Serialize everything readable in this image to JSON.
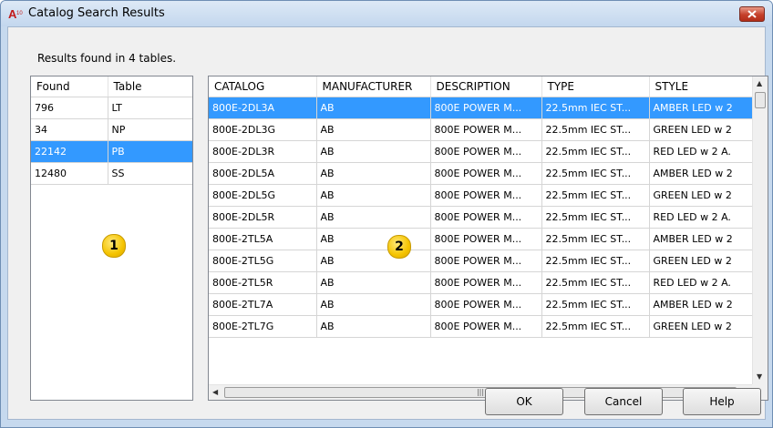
{
  "window": {
    "title": "Catalog Search Results",
    "app_icon_text": "A",
    "app_icon_sub": "10"
  },
  "summary": "Results found in 4 tables.",
  "left_table": {
    "headers": [
      "Found",
      "Table"
    ],
    "rows": [
      {
        "found": "796",
        "table": "LT"
      },
      {
        "found": "34",
        "table": "NP"
      },
      {
        "found": "22142",
        "table": "PB",
        "selected": true
      },
      {
        "found": "12480",
        "table": "SS"
      }
    ]
  },
  "right_table": {
    "headers": [
      "CATALOG",
      "MANUFACTURER",
      "DESCRIPTION",
      "TYPE",
      "STYLE"
    ],
    "rows": [
      [
        "800E-2DL3A",
        "AB",
        "800E POWER M...",
        "22.5mm IEC ST...",
        "AMBER LED w 2"
      ],
      [
        "800E-2DL3G",
        "AB",
        "800E POWER M...",
        "22.5mm IEC ST...",
        "GREEN LED w 2"
      ],
      [
        "800E-2DL3R",
        "AB",
        "800E POWER M...",
        "22.5mm IEC ST...",
        "RED LED w 2 A."
      ],
      [
        "800E-2DL5A",
        "AB",
        "800E POWER M...",
        "22.5mm IEC ST...",
        "AMBER LED w 2"
      ],
      [
        "800E-2DL5G",
        "AB",
        "800E POWER M...",
        "22.5mm IEC ST...",
        "GREEN LED w 2"
      ],
      [
        "800E-2DL5R",
        "AB",
        "800E POWER M...",
        "22.5mm IEC ST...",
        "RED LED w 2 A."
      ],
      [
        "800E-2TL5A",
        "AB",
        "800E POWER M...",
        "22.5mm IEC ST...",
        "AMBER LED w 2"
      ],
      [
        "800E-2TL5G",
        "AB",
        "800E POWER M...",
        "22.5mm IEC ST...",
        "GREEN LED w 2"
      ],
      [
        "800E-2TL5R",
        "AB",
        "800E POWER M...",
        "22.5mm IEC ST...",
        "RED LED w 2 A."
      ],
      [
        "800E-2TL7A",
        "AB",
        "800E POWER M...",
        "22.5mm IEC ST...",
        "AMBER LED w 2"
      ],
      [
        "800E-2TL7G",
        "AB",
        "800E POWER M...",
        "22.5mm IEC ST...",
        "GREEN LED w 2"
      ]
    ],
    "selected_row": 0
  },
  "callouts": {
    "left": "1",
    "right": "2"
  },
  "buttons": {
    "ok": "OK",
    "cancel": "Cancel",
    "help": "Help"
  },
  "colors": {
    "selection": "#3399ff",
    "callout": "#f5c400",
    "close_button": "#c5402a"
  }
}
